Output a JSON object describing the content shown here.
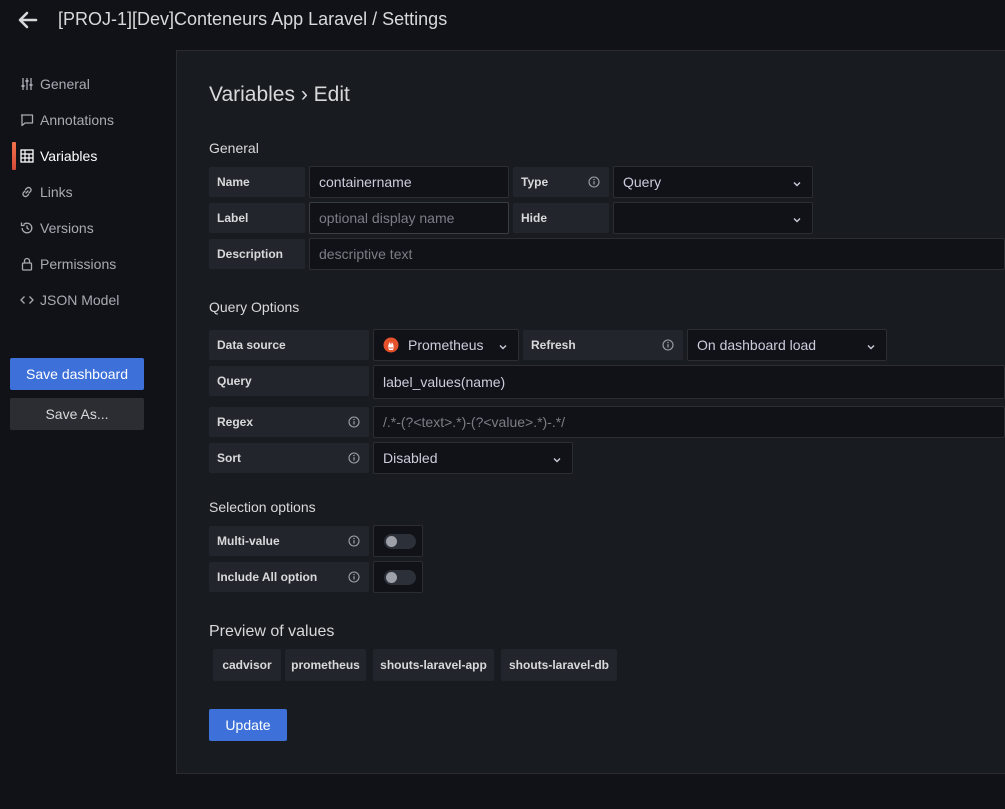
{
  "header": {
    "title": "[PROJ-1][Dev]Conteneurs App Laravel / Settings"
  },
  "sidebar": {
    "items": [
      {
        "label": "General",
        "icon": "sliders-icon"
      },
      {
        "label": "Annotations",
        "icon": "comment-icon"
      },
      {
        "label": "Variables",
        "icon": "calculator-icon",
        "active": true
      },
      {
        "label": "Links",
        "icon": "link-icon"
      },
      {
        "label": "Versions",
        "icon": "history-icon"
      },
      {
        "label": "Permissions",
        "icon": "lock-icon"
      },
      {
        "label": "JSON Model",
        "icon": "code-icon"
      }
    ],
    "save_label": "Save dashboard",
    "save_as_label": "Save As..."
  },
  "editor": {
    "title": "Variables › Edit",
    "general": {
      "heading": "General",
      "name_label": "Name",
      "name_value": "containername",
      "type_label": "Type",
      "type_value": "Query",
      "label_label": "Label",
      "label_placeholder": "optional display name",
      "hide_label": "Hide",
      "hide_value": "",
      "description_label": "Description",
      "description_placeholder": "descriptive text"
    },
    "query_options": {
      "heading": "Query Options",
      "datasource_label": "Data source",
      "datasource_value": "Prometheus",
      "refresh_label": "Refresh",
      "refresh_value": "On dashboard load",
      "query_label": "Query",
      "query_value": "label_values(name)",
      "regex_label": "Regex",
      "regex_value": "/.*-(?<text>.*)-(?<value>.*)-.*/",
      "sort_label": "Sort",
      "sort_value": "Disabled"
    },
    "selection_options": {
      "heading": "Selection options",
      "multi_value_label": "Multi-value",
      "multi_value_enabled": false,
      "include_all_label": "Include All option",
      "include_all_enabled": false
    },
    "preview": {
      "heading": "Preview of values",
      "values": [
        "cadvisor",
        "prometheus",
        "shouts-laravel-app",
        "shouts-laravel-db"
      ]
    },
    "update_label": "Update"
  },
  "colors": {
    "accent": "#3d71d9",
    "active_bar": "#f2734a",
    "prometheus": "#e6522c"
  }
}
